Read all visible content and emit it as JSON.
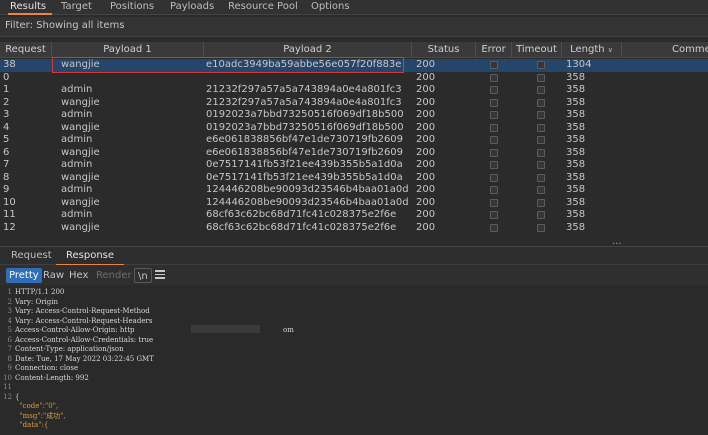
{
  "top_tabs": [
    "Results",
    "Target",
    "Positions",
    "Payloads",
    "Resource Pool",
    "Options"
  ],
  "filter": {
    "text": "Filter: Showing all items"
  },
  "table": {
    "columns": [
      "Request",
      "Payload 1",
      "Payload 2",
      "Status",
      "Error",
      "Timeout",
      "Length",
      "Comment"
    ],
    "sort_icon": "chevron-down-icon",
    "rows": [
      [
        "38",
        "wangjie",
        "e10adc3949ba59abbe56e057f20f883e",
        "200",
        "1304"
      ],
      [
        "0",
        "",
        "",
        "200",
        "358"
      ],
      [
        "1",
        "admin",
        "21232f297a57a5a743894a0e4a801fc3",
        "200",
        "358"
      ],
      [
        "2",
        "wangjie",
        "21232f297a57a5a743894a0e4a801fc3",
        "200",
        "358"
      ],
      [
        "3",
        "admin",
        "0192023a7bbd73250516f069df18b500",
        "200",
        "358"
      ],
      [
        "4",
        "wangjie",
        "0192023a7bbd73250516f069df18b500",
        "200",
        "358"
      ],
      [
        "5",
        "admin",
        "e6e061838856bf47e1de730719fb2609",
        "200",
        "358"
      ],
      [
        "6",
        "wangjie",
        "e6e061838856bf47e1de730719fb2609",
        "200",
        "358"
      ],
      [
        "7",
        "admin",
        "0e7517141fb53f21ee439b355b5a1d0a",
        "200",
        "358"
      ],
      [
        "8",
        "wangjie",
        "0e7517141fb53f21ee439b355b5a1d0a",
        "200",
        "358"
      ],
      [
        "9",
        "admin",
        "124446208be90093d23546b4baa01a0d",
        "200",
        "358"
      ],
      [
        "10",
        "wangjie",
        "124446208be90093d23546b4baa01a0d",
        "200",
        "358"
      ],
      [
        "11",
        "admin",
        "68cf63c62bc68d71fc41c028375e2f6e",
        "200",
        "358"
      ],
      [
        "12",
        "wangjie",
        "68cf63c62bc68d71fc41c028375e2f6e",
        "200",
        "358"
      ]
    ],
    "more": "..."
  },
  "rr_tabs": {
    "request": "Request",
    "response": "Response"
  },
  "view_modes": {
    "pretty": "Pretty",
    "raw": "Raw",
    "hex": "Hex",
    "render": "Render",
    "newline": "\\n",
    "menu_icon": "menu-icon"
  },
  "editor": {
    "lines": [
      {
        "n": "1",
        "text": "HTTP/1.1 200"
      },
      {
        "n": "2",
        "text": "Vary: Origin"
      },
      {
        "n": "3",
        "text": "Vary: Access-Control-Request-Method"
      },
      {
        "n": "4",
        "text": "Vary: Access-Control-Request-Headers"
      },
      {
        "n": "5",
        "text": "Access-Control-Allow-Origin: http",
        "tail": "om"
      },
      {
        "n": "6",
        "text": "Access-Control-Allow-Credentials: true"
      },
      {
        "n": "7",
        "text": "Content-Type: application/json"
      },
      {
        "n": "8",
        "text": "Date: Tue, 17 May 2022 03:22:45 GMT"
      },
      {
        "n": "9",
        "text": "Connection: close"
      },
      {
        "n": "10",
        "text": "Content-Length: 992"
      },
      {
        "n": "11",
        "text": ""
      },
      {
        "n": "12",
        "text": "{"
      },
      {
        "n": "",
        "text": "  \"code\":\"0\","
      },
      {
        "n": "",
        "text": "  \"msg\":\"成功\","
      },
      {
        "n": "",
        "text": "  \"data\":{"
      }
    ]
  },
  "colors": {
    "accent": "#e8863f",
    "selected_row": "#26456b",
    "highlight_box": "#d33b3b",
    "pretty_button": "#2f6db8"
  }
}
